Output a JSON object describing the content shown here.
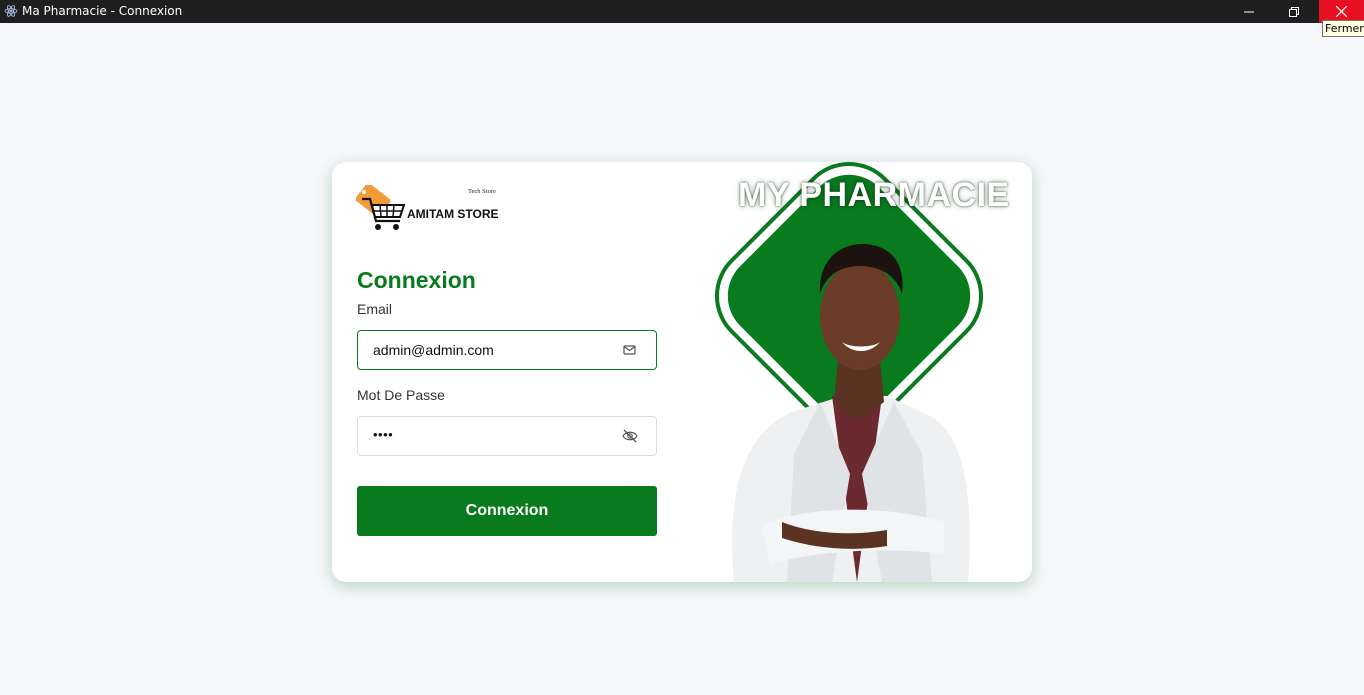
{
  "window": {
    "title": "Ma Pharmacie - Connexion",
    "tooltip": "Fermer",
    "icons": {
      "app": "electron-icon",
      "minimize": "minimize-icon",
      "maximize": "restore-icon",
      "close": "close-icon"
    }
  },
  "logo": {
    "tagline": "Tech Store",
    "brand": "AMITAM STORE",
    "icon": "shopping-cart-icon"
  },
  "form": {
    "heading": "Connexion",
    "email_label": "Email",
    "email_value": "admin@admin.com",
    "email_icon": "mail-icon",
    "password_label": "Mot De Passe",
    "password_value": "••••",
    "password_icon": "eye-off-icon",
    "submit_label": "Connexion"
  },
  "hero": {
    "title": "MY PHARMACIE",
    "image": "pharmacist-photo"
  },
  "colors": {
    "accent": "#0a7a1e",
    "close_button": "#e81123",
    "logo_orange": "#f29a38"
  }
}
